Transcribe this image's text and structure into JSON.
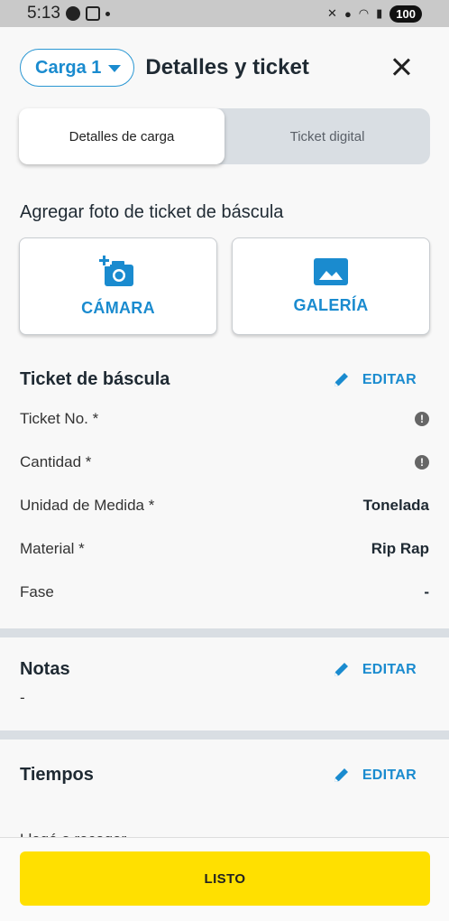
{
  "status_bar": {
    "time": "5:13",
    "battery": "100"
  },
  "header": {
    "load_selector": "Carga 1",
    "title": "Detalles y ticket"
  },
  "tabs": [
    {
      "label": "Detalles de carga",
      "active": true
    },
    {
      "label": "Ticket digital",
      "active": false
    }
  ],
  "photo": {
    "label": "Agregar foto de ticket de báscula",
    "camera": "CÁMARA",
    "gallery": "GALERÍA"
  },
  "ticket": {
    "title": "Ticket de báscula",
    "edit": "EDITAR",
    "rows": [
      {
        "label": "Ticket No. *",
        "value": "",
        "icon": "info-icon"
      },
      {
        "label": "Cantidad *",
        "value": "",
        "icon": "info-icon"
      },
      {
        "label": "Unidad de Medida *",
        "value": "Tonelada"
      },
      {
        "label": "Material *",
        "value": "Rip Rap"
      },
      {
        "label": "Fase",
        "value": "-"
      }
    ]
  },
  "notes": {
    "title": "Notas",
    "edit": "EDITAR",
    "value": "-"
  },
  "times": {
    "title": "Tiempos",
    "edit": "EDITAR",
    "first_row": "Llegó a recoger"
  },
  "footer": {
    "done": "LISTO"
  },
  "colors": {
    "accent": "#1a8bcf",
    "primary_button": "#ffe000",
    "divider": "#d9dee3"
  }
}
